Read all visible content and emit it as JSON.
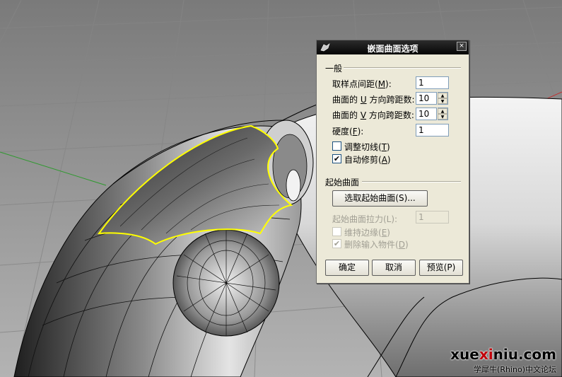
{
  "dialog": {
    "title": "嵌面曲面选项",
    "close_glyph": "×",
    "group_general": "一般",
    "fields": [
      {
        "pre": "取样点间距(",
        "key": "M",
        "post": "):",
        "value": "1"
      },
      {
        "pre": "曲面的 ",
        "key": "U",
        "post": " 方向跨距数:",
        "value": "10"
      },
      {
        "pre": "曲面的 ",
        "key": "V",
        "post": " 方向跨距数:",
        "value": "10"
      },
      {
        "pre": "硬度(",
        "key": "F",
        "post": "):",
        "value": "1"
      }
    ],
    "checks_general": [
      {
        "pre": "调整切线(",
        "key": "T",
        "post": ")",
        "checked": false,
        "mark": ""
      },
      {
        "pre": "自动修剪(",
        "key": "A",
        "post": ")",
        "checked": true,
        "mark": "✔"
      }
    ],
    "group_start": "起始曲面",
    "pick_button": "选取起始曲面(S)...",
    "stretch_label": "起始曲面拉力(L):",
    "stretch_value": "1",
    "checks_start": [
      {
        "pre": "维持边缘(",
        "key": "E",
        "post": ")",
        "checked": false,
        "mark": ""
      },
      {
        "pre": "删除输入物件(",
        "key": "D",
        "post": ")",
        "checked": true,
        "mark": "✔"
      }
    ],
    "buttons": {
      "ok": "确定",
      "cancel": "取消",
      "preview": "预览(P)"
    }
  },
  "watermark": {
    "site_pre": "xue",
    "site_hl": "xi",
    "site_post": "niu.com",
    "forum": "学犀牛(Rhino)中文论坛"
  },
  "colors": {
    "edge_highlight": "#ffff00",
    "axis_x": "#c03030",
    "axis_y": "#2f9a2f"
  }
}
